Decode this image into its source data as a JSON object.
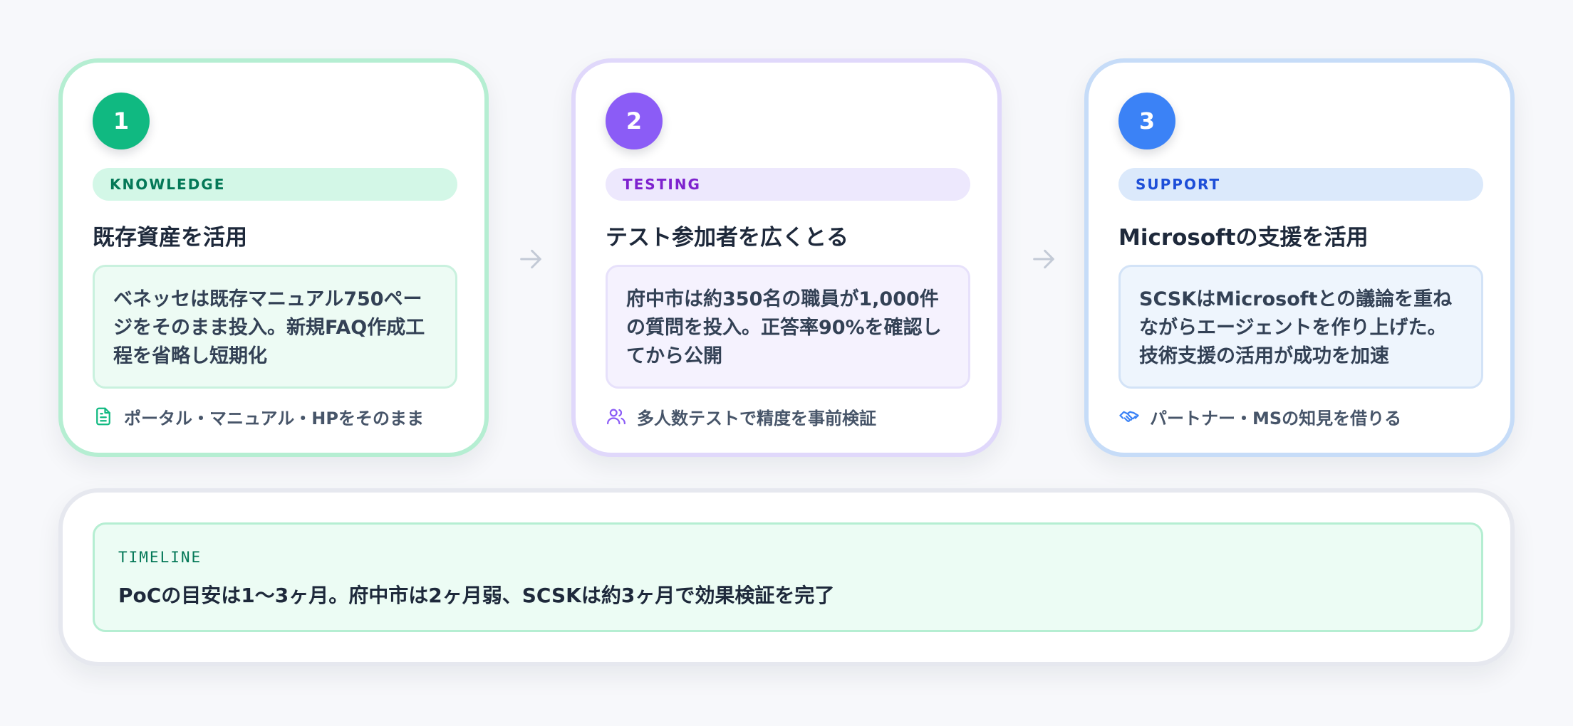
{
  "cards": [
    {
      "number": "1",
      "tag": "KNOWLEDGE",
      "title": "既存資産を活用",
      "description": "ベネッセは既存マニュアル750ページをそのまま投入。新規FAQ作成工程を省略し短期化",
      "footer": "ポータル・マニュアル・HPをそのまま",
      "icon": "document-icon",
      "color": "#10b981"
    },
    {
      "number": "2",
      "tag": "TESTING",
      "title": "テスト参加者を広くとる",
      "description": "府中市は約350名の職員が1,000件の質問を投入。正答率90%を確認してから公開",
      "footer": "多人数テストで精度を事前検証",
      "icon": "users-icon",
      "color": "#8b5cf6"
    },
    {
      "number": "3",
      "tag": "SUPPORT",
      "title": "Microsoftの支援を活用",
      "description": "SCSKはMicrosoftとの議論を重ねながらエージェントを作り上げた。技術支援の活用が成功を加速",
      "footer": "パートナー・MSの知見を借りる",
      "icon": "handshake-icon",
      "color": "#3b82f6"
    }
  ],
  "timeline": {
    "label": "TIMELINE",
    "text": "PoCの目安は1〜3ヶ月。府中市は2ヶ月弱、SCSKは約3ヶ月で効果検証を完了"
  }
}
